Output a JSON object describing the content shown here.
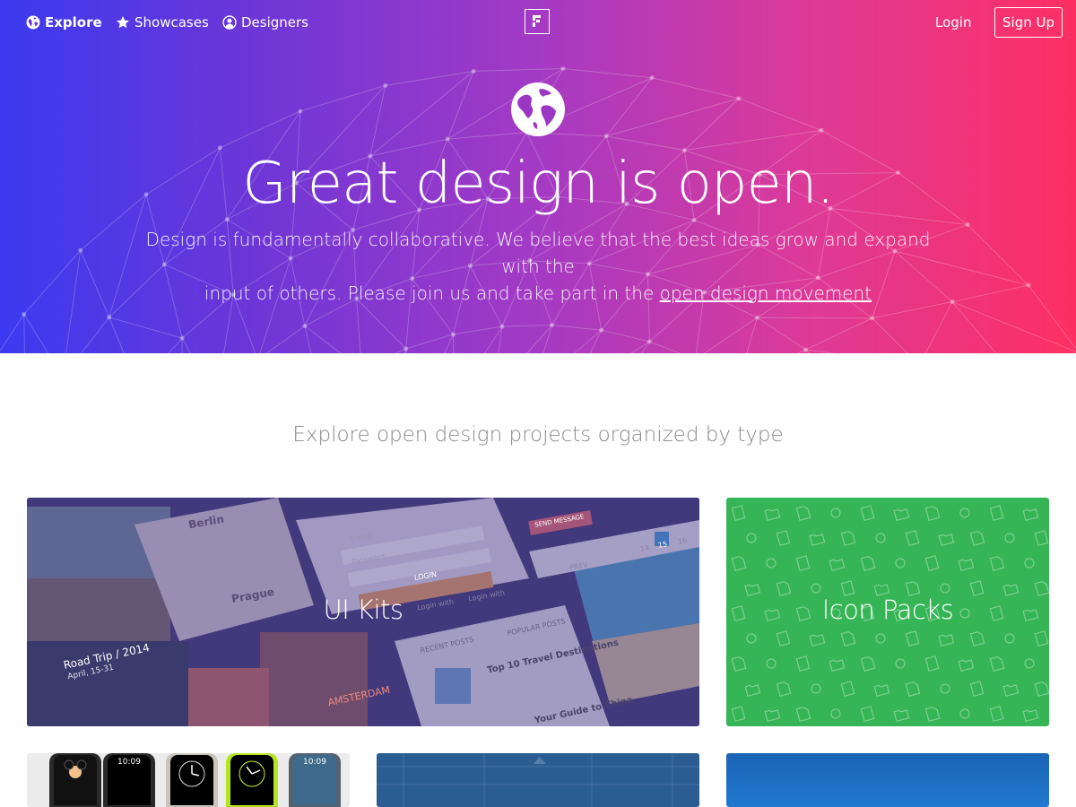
{
  "nav": {
    "explore_label": "Explore",
    "showcases_label": "Showcases",
    "designers_label": "Designers",
    "login_label": "Login",
    "signup_label": "Sign Up"
  },
  "hero": {
    "title": "Great design is open.",
    "subtitle_line1": "Design is fundamentally collaborative. We believe that the best ideas grow and expand with the",
    "subtitle_line2": "input of others. Please join us and take part in the ",
    "subtitle_link": "open design movement"
  },
  "section": {
    "heading": "Explore open design projects organized by type"
  },
  "cards": {
    "ui_kits": "UI Kits",
    "icon_packs": "Icon Packs"
  },
  "mock_text": {
    "berlin": "Berlin",
    "prague": "Prague",
    "road_trip": "Road Trip / 2014",
    "road_dates": "April, 15-31",
    "amsterdam": "AMSTERDAM",
    "recent_posts": "RECENT POSTS",
    "popular_posts": "POPULAR POSTS",
    "post1": "Top 10 Travel Destinations",
    "post2": "Your Guide to China",
    "prev": "PREV",
    "page14": "14",
    "page15": "15",
    "page16": "16",
    "login_twitter": "Login with",
    "login_fb": "Login with",
    "login_btn": "LOGIN",
    "send_msg": "SEND MESSAGE",
    "email": "E-Mail",
    "password": "Password"
  },
  "watch_times": [
    "",
    "10:09",
    "",
    "",
    "10:09"
  ],
  "colors": {
    "hero_left": "#3b3af0",
    "hero_mid": "#a43ac4",
    "hero_right": "#fd2f62",
    "icon_packs_green": "#36b556",
    "ui_kits_purple": "#4d3f86",
    "section_heading": "#8a8a8a"
  },
  "icons": [
    "globe-icon",
    "star-icon",
    "user-icon",
    "logo-mark-icon",
    "hero-globe-icon"
  ]
}
